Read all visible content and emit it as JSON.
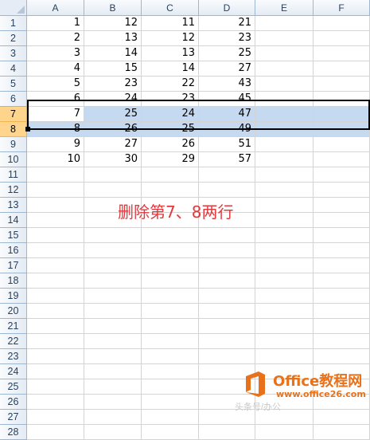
{
  "columns": [
    "A",
    "B",
    "C",
    "D",
    "E",
    "F"
  ],
  "row_numbers": [
    "1",
    "2",
    "3",
    "4",
    "5",
    "6",
    "7",
    "8",
    "9",
    "10",
    "11",
    "12",
    "13",
    "14",
    "15",
    "16",
    "17",
    "18",
    "19",
    "20",
    "21",
    "22",
    "23",
    "24",
    "25",
    "26",
    "27",
    "28"
  ],
  "rows": [
    [
      "1",
      "12",
      "11",
      "21"
    ],
    [
      "2",
      "13",
      "12",
      "23"
    ],
    [
      "3",
      "14",
      "13",
      "25"
    ],
    [
      "4",
      "15",
      "14",
      "27"
    ],
    [
      "5",
      "23",
      "22",
      "43"
    ],
    [
      "6",
      "24",
      "23",
      "45"
    ],
    [
      "7",
      "25",
      "24",
      "47"
    ],
    [
      "8",
      "26",
      "25",
      "49"
    ],
    [
      "9",
      "27",
      "26",
      "51"
    ],
    [
      "10",
      "30",
      "29",
      "57"
    ]
  ],
  "selected_rows": [
    7,
    8
  ],
  "annotation": "删除第7、8两行",
  "watermark": {
    "title": "Office教程网",
    "url": "www.office26.com",
    "subtext": "头条号/办公"
  },
  "colors": {
    "selection_fill": "#c5d9f1",
    "selected_header": "#ffd58d",
    "annotation": "#e0393e",
    "watermark": "#e8721c"
  }
}
